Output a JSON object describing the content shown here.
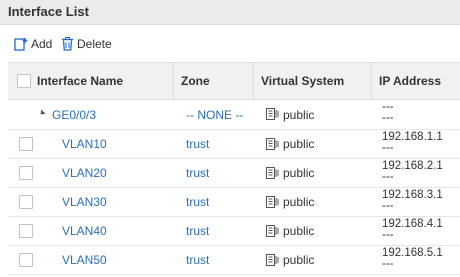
{
  "panel": {
    "title": "Interface List"
  },
  "toolbar": {
    "add_label": "Add",
    "delete_label": "Delete"
  },
  "table": {
    "columns": [
      "Interface Name",
      "Zone",
      "Virtual System",
      "IP Address"
    ],
    "rows": [
      {
        "name": "GE0/0/3",
        "zone": "-- NONE --",
        "vsys": "public",
        "ip1": "---",
        "ip2": "---"
      },
      {
        "name": "VLAN10",
        "zone": "trust",
        "vsys": "public",
        "ip1": "192.168.1.1",
        "ip2": "---"
      },
      {
        "name": "VLAN20",
        "zone": "trust",
        "vsys": "public",
        "ip1": "192.168.2.1",
        "ip2": "---"
      },
      {
        "name": "VLAN30",
        "zone": "trust",
        "vsys": "public",
        "ip1": "192.168.3.1",
        "ip2": "---"
      },
      {
        "name": "VLAN40",
        "zone": "trust",
        "vsys": "public",
        "ip1": "192.168.4.1",
        "ip2": "---"
      },
      {
        "name": "VLAN50",
        "zone": "trust",
        "vsys": "public",
        "ip1": "192.168.5.1",
        "ip2": "---"
      }
    ]
  },
  "colors": {
    "link": "#2a6fb6",
    "header_bg": "#f1f1f1",
    "toolbar_icon": "#1e6cc8"
  },
  "icons": {
    "add": "add-icon",
    "delete": "trash-icon",
    "vsys": "virtual-system-icon",
    "expand": "expand-arrow-icon"
  }
}
